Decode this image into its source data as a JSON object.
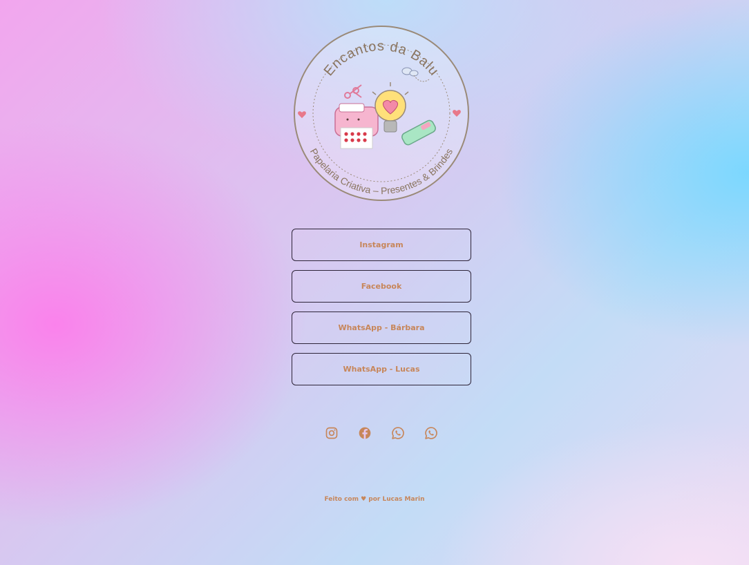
{
  "logo": {
    "title_top": "Encantos da Balu",
    "title_bottom": "Papelaria Criativa – Presentes & Brindes",
    "icon": "stationery-illustration"
  },
  "links": [
    {
      "label": "Instagram"
    },
    {
      "label": "Facebook"
    },
    {
      "label": "WhatsApp - Bárbara"
    },
    {
      "label": "WhatsApp - Lucas"
    }
  ],
  "socials": [
    {
      "icon": "instagram-icon"
    },
    {
      "icon": "facebook-icon"
    },
    {
      "icon": "whatsapp-icon"
    },
    {
      "icon": "whatsapp-icon"
    }
  ],
  "footer": {
    "text": "Feito com ♥ por Lucas Marin"
  },
  "colors": {
    "accent": "#c7865a",
    "button_border": "#2d2438",
    "logo_ring": "#9a8a78"
  }
}
